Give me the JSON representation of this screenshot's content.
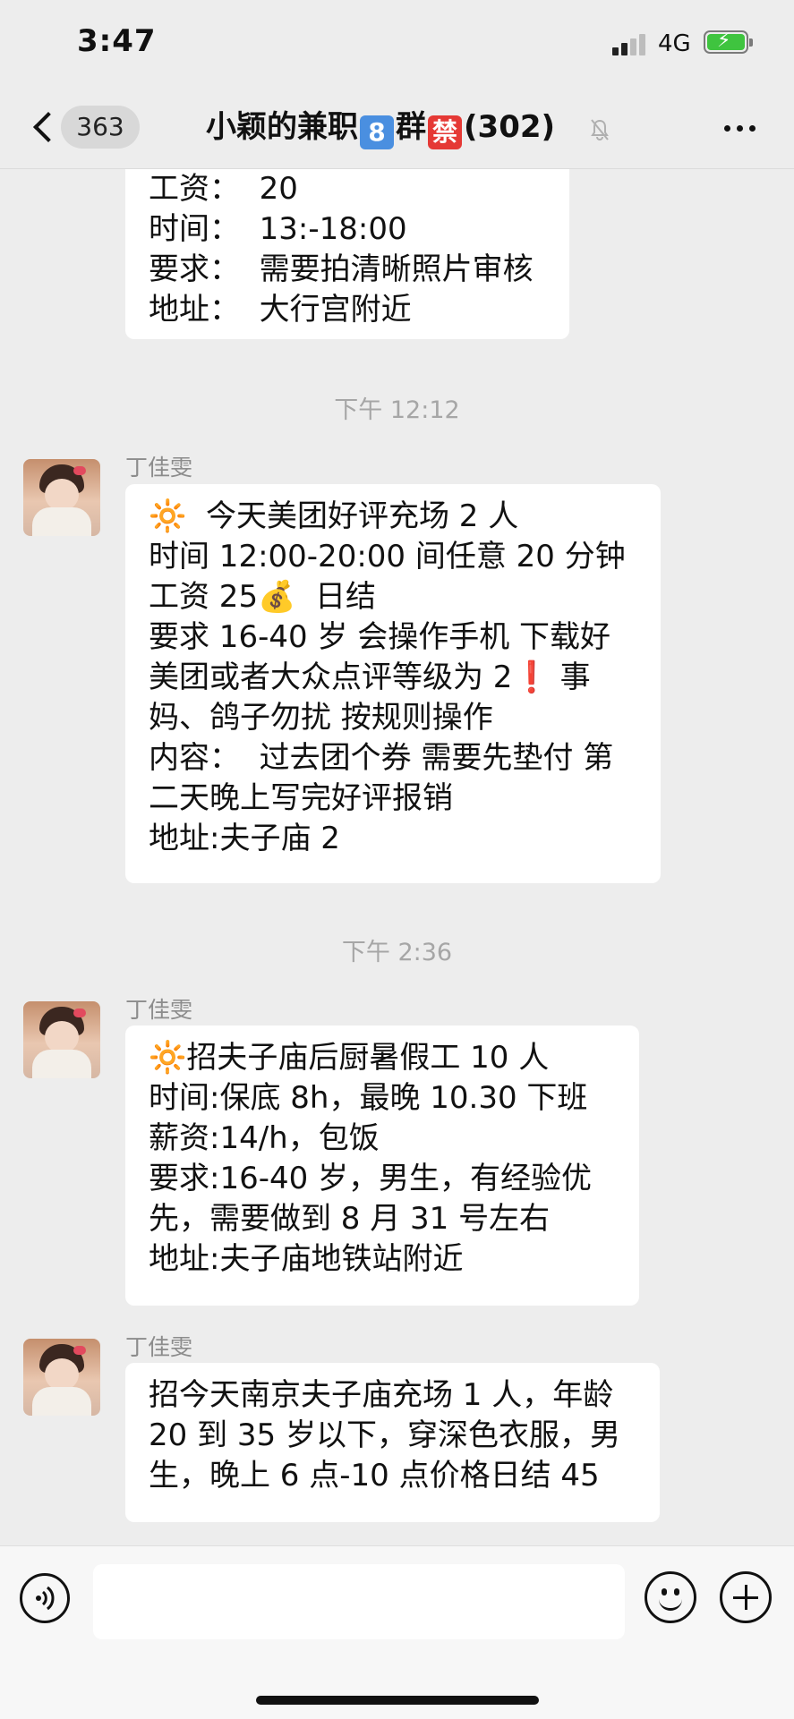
{
  "status_bar": {
    "time": "3:47",
    "network": "4G",
    "battery_charging": true
  },
  "nav": {
    "unread_count": "363",
    "title_prefix": "小颖的兼职",
    "title_badge_number": "8",
    "title_mid": "群",
    "title_badge_forbidden": "禁",
    "member_count": "(302)",
    "muted": true
  },
  "messages": [
    {
      "type": "text",
      "partial": true,
      "text": "工资：  20\n时间：  13:-18:00\n要求：  需要拍清晰照片审核\n地址：  大行宫附近"
    },
    {
      "type": "timestamp",
      "text": "下午 12:12"
    },
    {
      "type": "text",
      "sender": "丁佳雯",
      "text": "🔆  今天美团好评充场 2 人\n时间 12:00-20:00 间任意 20 分钟\n工资 25💰  日结\n要求 16-40 岁 会操作手机 下载好美团或者大众点评等级为 2❗ 事妈、鸽子勿扰 按规则操作\n内容：  过去团个券 需要先垫付 第二天晚上写完好评报销\n地址:夫子庙 2"
    },
    {
      "type": "timestamp",
      "text": "下午 2:36"
    },
    {
      "type": "text",
      "sender": "丁佳雯",
      "text": "🔆招夫子庙后厨暑假工 10 人\n时间:保底 8h，最晚 10.30 下班\n薪资:14/h，包饭\n要求:16-40 岁，男生，有经验优先，需要做到 8 月 31 号左右\n地址:夫子庙地铁站附近"
    },
    {
      "type": "text",
      "sender": "丁佳雯",
      "text": "招今天南京夫子庙充场 1 人，年龄 20 到 35 岁以下，穿深色衣服，男生，晚上 6 点-10 点价格日结 45"
    }
  ],
  "input": {
    "placeholder": ""
  },
  "colors": {
    "background": "#ededed",
    "bubble": "#ffffff",
    "timestamp": "#a6a6a6",
    "sender": "#8c8c8c"
  }
}
